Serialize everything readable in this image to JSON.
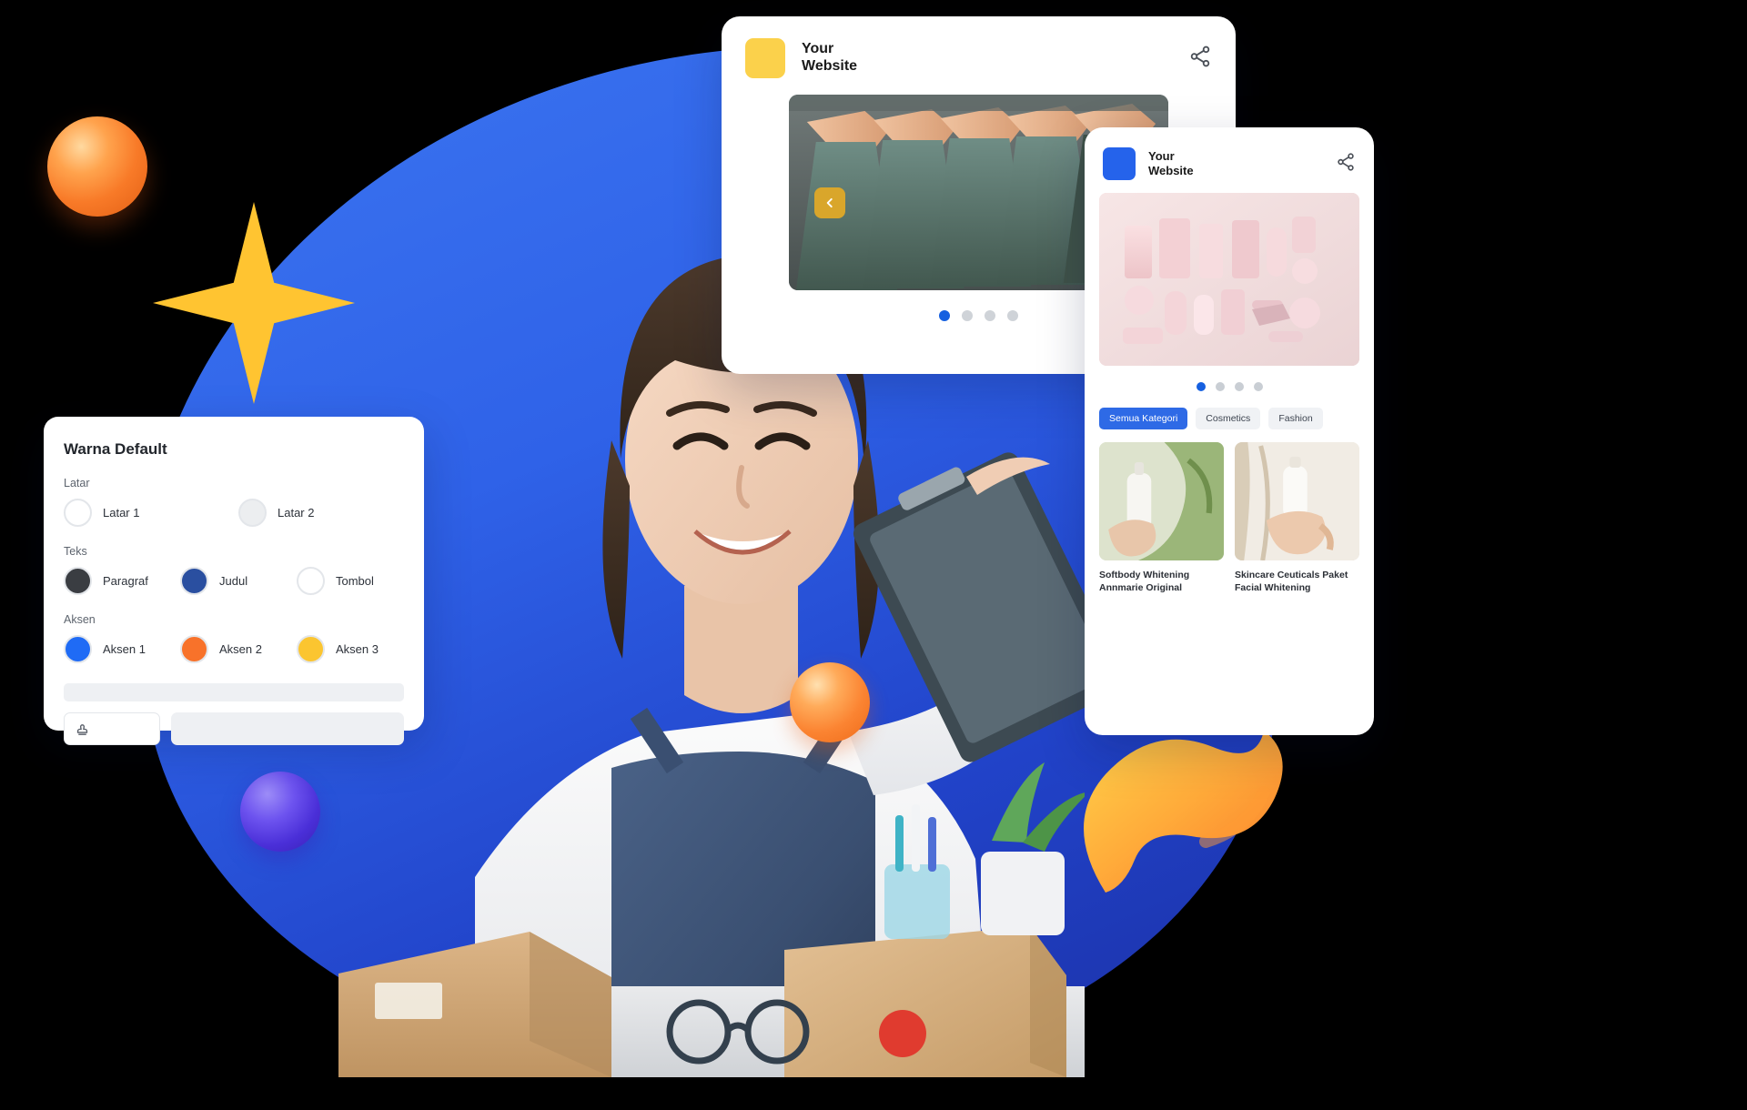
{
  "background": {
    "blob_color": "#2f62e8",
    "star_color": "#ffc431",
    "accent_orange": "#f87a28",
    "accent_purple": "#5a3ce0"
  },
  "card_website_1": {
    "logo_color": "#fbd14b",
    "title_line1": "Your",
    "title_line2": "Website",
    "share_icon": "share-icon",
    "prev_arrow_icon": "chevron-left-icon",
    "hero_alt": "green t-shirts on wooden hangers",
    "carousel": {
      "total": 4,
      "active_index": 0
    }
  },
  "card_website_2": {
    "logo_color": "#2563eb",
    "title_line1": "Your",
    "title_line2": "Website",
    "share_icon": "share-icon",
    "hero_alt": "pink cosmetics product flatlay",
    "carousel": {
      "total": 4,
      "active_index": 0
    },
    "categories": [
      {
        "label": "Semua Kategori",
        "active": true
      },
      {
        "label": "Cosmetics",
        "active": false
      },
      {
        "label": "Fashion",
        "active": false
      }
    ],
    "products": [
      {
        "title": "Softbody Whitening Annmarie Original",
        "image_alt": "hand holding white pump bottle with plant"
      },
      {
        "title": "Skincare Ceuticals Paket Facial Whitening",
        "image_alt": "hand holding white tube with dried grass"
      }
    ]
  },
  "panel_warna": {
    "title": "Warna Default",
    "groups": [
      {
        "label": "Latar",
        "options": [
          {
            "label": "Latar 1",
            "color": "#ffffff",
            "selected": false
          },
          {
            "label": "Latar 2",
            "color": "#eceef0",
            "selected": false
          }
        ]
      },
      {
        "label": "Teks",
        "options": [
          {
            "label": "Paragraf",
            "color": "#3a3d42",
            "selected": true
          },
          {
            "label": "Judul",
            "color": "#2a4fa0",
            "selected": true
          },
          {
            "label": "Tombol",
            "color": "#ffffff",
            "selected": false
          }
        ]
      },
      {
        "label": "Aksen",
        "options": [
          {
            "label": "Aksen 1",
            "color": "#1f6bf5",
            "selected": true
          },
          {
            "label": "Aksen 2",
            "color": "#f8722a",
            "selected": true
          },
          {
            "label": "Aksen 3",
            "color": "#fbc530",
            "selected": true
          }
        ]
      }
    ],
    "preview_bar_color": "#eef0f3",
    "stamp_icon": "stamp-icon"
  }
}
